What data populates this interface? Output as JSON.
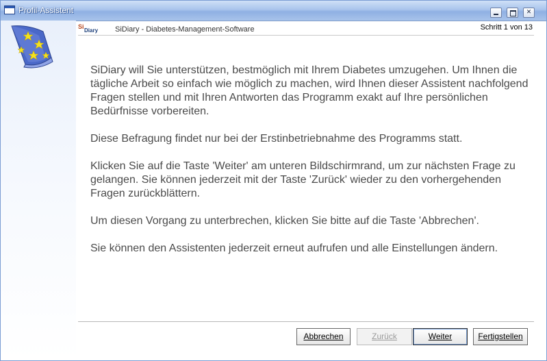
{
  "window": {
    "title": "Profil-Assistent"
  },
  "header": {
    "logo_si": "Si",
    "logo_diary": "Diary",
    "subtitle": "SiDiary - Diabetes-Management-Software",
    "step": "Schritt 1 von 13"
  },
  "content": {
    "paragraphs": [
      "SiDiary will Sie unterstützen, bestmöglich mit Ihrem Diabetes umzugehen. Um Ihnen die tägliche Arbeit so einfach wie möglich zu machen, wird Ihnen dieser Assistent nachfolgend Fragen stellen und mit Ihren Antworten das Programm exakt auf Ihre persönlichen Bedürfnisse vorbereiten.",
      "Diese Befragung findet nur bei der Erstinbetriebnahme des Programms statt.",
      "Klicken Sie auf die Taste 'Weiter' am unteren Bildschirmrand, um zur nächsten Frage zu gelangen. Sie können jederzeit mit der Taste 'Zurück' wieder zu den vorhergehenden Fragen zurückblättern.",
      "Um diesen Vorgang zu unterbrechen, klicken Sie bitte auf die Taste 'Abbrechen'.",
      "Sie können den Assistenten jederzeit erneut aufrufen und alle Einstellungen ändern."
    ]
  },
  "buttons": {
    "cancel": "Abbrechen",
    "back": "Zurück",
    "next": "Weiter",
    "finish": "Fertigstellen"
  },
  "icons": {
    "app": "window-icon",
    "wizard": "wizard-hat-icon"
  },
  "colors": {
    "titlebar": "#a9c4ec",
    "hat": "#4a68c8",
    "stars": "#f4e21c",
    "text": "#4a4a4a"
  }
}
